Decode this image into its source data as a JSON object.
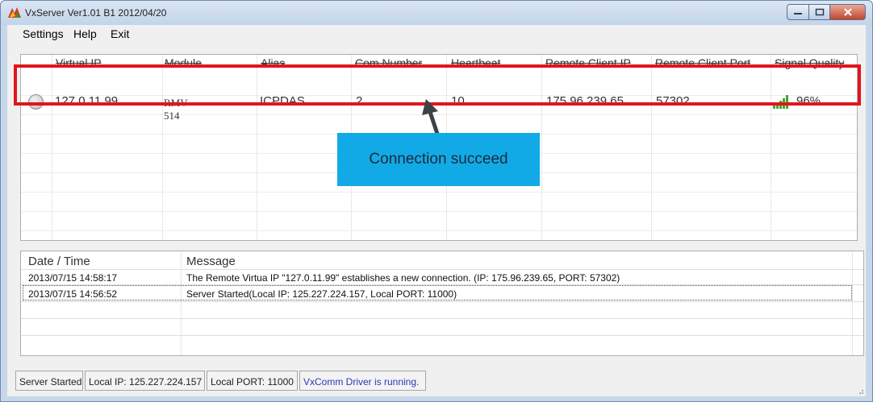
{
  "window": {
    "title": "VxServer Ver1.01 B1 2012/04/20"
  },
  "menu": [
    "Settings",
    "Help",
    "Exit"
  ],
  "table": {
    "columns": [
      "Virtual IP",
      "Module",
      "Alias",
      "Com Number",
      "Heartbeat",
      "Remote Client IP",
      "Remote Client Port",
      "Signal Quality"
    ],
    "rows": [
      {
        "virtual_ip": "127.0.11.99",
        "module": "RMV-514",
        "alias": "ICPDAS",
        "com_number": "2",
        "heartbeat": "10",
        "remote_client_ip": "175.96.239.65",
        "remote_client_port": "57302",
        "signal_quality": "96%",
        "signal_icon": "signal-bars-icon"
      }
    ]
  },
  "annotation": {
    "text": "Connection succeed",
    "box_color": "#e0161b",
    "callout_color": "#12aae6"
  },
  "log": {
    "columns": [
      "Date / Time",
      "Message"
    ],
    "rows": [
      {
        "datetime": "2013/07/15 14:58:17",
        "message": "The Remote Virtua IP \"127.0.11.99\" establishes a new connection. (IP: 175.96.239.65, PORT: 57302)"
      },
      {
        "datetime": "2013/07/15 14:56:52",
        "message": "Server Started(Local IP: 125.227.224.157, Local PORT: 11000)"
      }
    ]
  },
  "status": {
    "server": "Server Started",
    "local_ip": "Local IP: 125.227.224.157",
    "local_port": "Local PORT: 11000",
    "driver": "VxComm Driver is running.",
    "driver_color": "#2d36b8"
  }
}
